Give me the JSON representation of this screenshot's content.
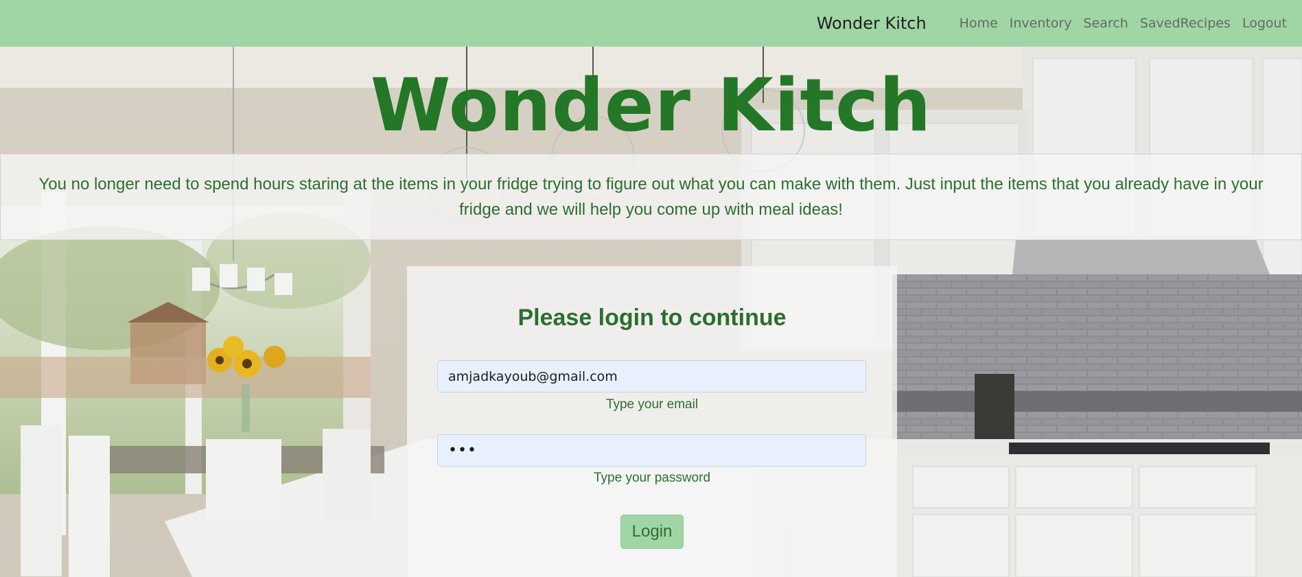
{
  "navbar": {
    "brand": "Wonder Kitch",
    "links": [
      "Home",
      "Inventory",
      "Search",
      "SavedRecipes",
      "Logout"
    ]
  },
  "hero": {
    "title": "Wonder Kitch"
  },
  "intro": {
    "text": "You no longer need to spend hours staring at the items in your fridge trying to figure out what you can make with them. Just input the items that you already have in your fridge and we will help you come up with meal ideas!"
  },
  "login": {
    "heading": "Please login to continue",
    "email_value": "amjadkayoub@gmail.com",
    "email_hint": "Type your email",
    "password_value": "•••",
    "password_hint": "Type your password",
    "button_label": "Login"
  },
  "colors": {
    "navbar_bg": "#a0d5a5",
    "accent_green": "#237727",
    "text_green": "#2c6e2f",
    "input_bg": "#e8f0fe"
  },
  "background": {
    "icon": "kitchen-photo"
  }
}
